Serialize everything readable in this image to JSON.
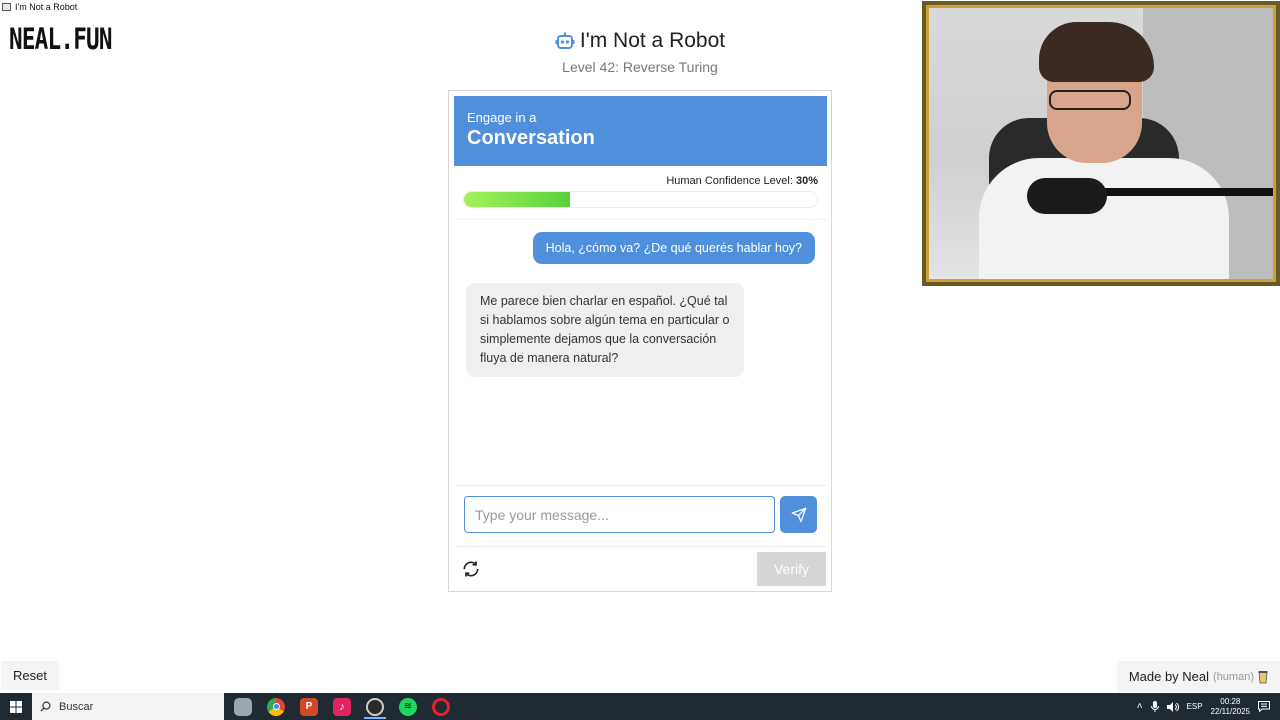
{
  "window": {
    "title": "I'm Not a Robot"
  },
  "logo": {
    "text": "NEAL.FUN"
  },
  "header": {
    "title": "I'm Not a Robot",
    "level": "Level 42: Reverse Turing"
  },
  "banner": {
    "small": "Engage in a",
    "big": "Conversation"
  },
  "confidence": {
    "label": "Human Confidence Level:",
    "value": "30%",
    "level": 0.3
  },
  "chat": {
    "user_message": "Hola, ¿cómo va? ¿De qué querés hablar hoy?",
    "bot_message": "Me parece bien charlar en español. ¿Qué tal si hablamos sobre algún tema en particular o simplemente dejamos que la conversación fluya de manera natural?"
  },
  "input": {
    "placeholder": "Type your message...",
    "value": ""
  },
  "buttons": {
    "verify": "Verify",
    "reset": "Reset"
  },
  "footer": {
    "made_by": "Made by Neal",
    "human": "(human)"
  },
  "taskbar": {
    "search_placeholder": "Buscar",
    "apps": [
      "shield-app-icon",
      "chrome-icon",
      "powerpoint-icon",
      "tiktok-icon",
      "obs-icon",
      "spotify-icon",
      "opera-icon"
    ],
    "language": "ESP",
    "time": "00:28",
    "date": "22/11/2025"
  },
  "colors": {
    "accent": "#4f8fdb",
    "progress": "#7be04a",
    "verify_disabled": "#d6d6d6",
    "webcam_frame": "#c9a33a"
  }
}
